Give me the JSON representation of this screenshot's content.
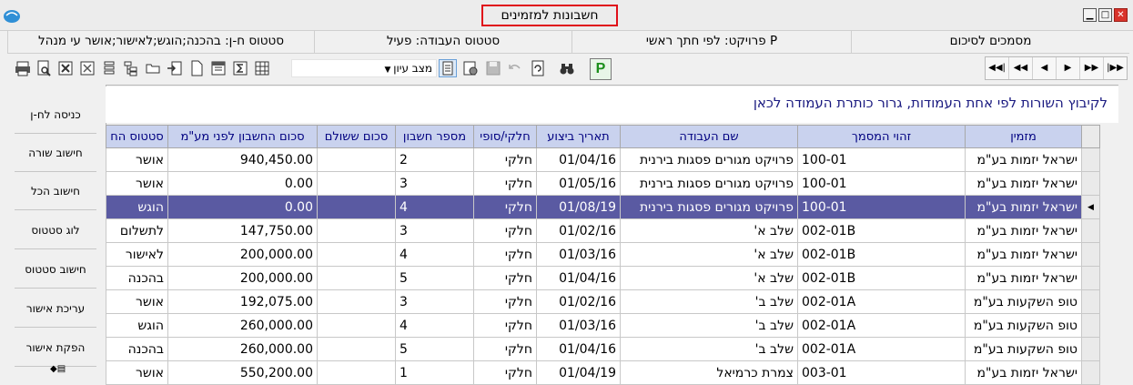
{
  "window": {
    "title": "חשבונות למזמינים"
  },
  "infobar": {
    "cells": [
      "סטטוס ח-ן: בהכנה;הוגש;לאישור;אושר עי מנהל",
      "סטטוס העבודה: פעיל",
      "פרויקט: לפי חתך ראשי P",
      "מסמכים לסיכום"
    ]
  },
  "toolbar": {
    "view_select": "מצב עיון",
    "p_button": "P"
  },
  "left_panel": {
    "buttons": [
      "כניסה לח-ן",
      "חישוב שורה",
      "חישוב הכל",
      "לוג סטטוס",
      "חישוב סטטוס",
      "עריכת אישור",
      "הפקת אישור"
    ]
  },
  "grid": {
    "group_hint": "לקיבוץ השורות לפי אחת העמודות, גרור כותרת העמודה לכאן",
    "columns": [
      "מזמין",
      "זהוי המסמך",
      "שם העבודה",
      "תאריך ביצוע",
      "חלקי/סופי",
      "מספר חשבון",
      "סכום ששולם",
      "סכום החשבון לפני מע\"מ",
      "סטטוס הח"
    ],
    "rows": [
      [
        "ישראל יזמות בע\"מ",
        "100-01",
        "פרויקט מגורים פסגות בירנית",
        "01/04/16",
        "חלקי",
        "2",
        "",
        "940,450.00",
        "אושר"
      ],
      [
        "ישראל יזמות בע\"מ",
        "100-01",
        "פרויקט מגורים פסגות בירנית",
        "01/05/16",
        "חלקי",
        "3",
        "",
        "0.00",
        "אושר"
      ],
      [
        "ישראל יזמות בע\"מ",
        "100-01",
        "פרויקט מגורים פסגות בירנית",
        "01/08/19",
        "חלקי",
        "4",
        "",
        "0.00",
        "הוגש"
      ],
      [
        "ישראל יזמות בע\"מ",
        "002-01B",
        "שלב א'",
        "01/02/16",
        "חלקי",
        "3",
        "",
        "147,750.00",
        "לתשלום"
      ],
      [
        "ישראל יזמות בע\"מ",
        "002-01B",
        "שלב א'",
        "01/03/16",
        "חלקי",
        "4",
        "",
        "200,000.00",
        "לאישור"
      ],
      [
        "ישראל יזמות בע\"מ",
        "002-01B",
        "שלב א'",
        "01/04/16",
        "חלקי",
        "5",
        "",
        "200,000.00",
        "בהכנה"
      ],
      [
        "טופ השקעות בע\"מ",
        "002-01A",
        "שלב ב'",
        "01/02/16",
        "חלקי",
        "3",
        "",
        "192,075.00",
        "אושר"
      ],
      [
        "טופ השקעות בע\"מ",
        "002-01A",
        "שלב ב'",
        "01/03/16",
        "חלקי",
        "4",
        "",
        "260,000.00",
        "הוגש"
      ],
      [
        "טופ השקעות בע\"מ",
        "002-01A",
        "שלב ב'",
        "01/04/16",
        "חלקי",
        "5",
        "",
        "260,000.00",
        "בהכנה"
      ],
      [
        "ישראל יזמות בע\"מ",
        "003-01",
        "צמרת כרמיאל",
        "01/04/19",
        "חלקי",
        "1",
        "",
        "550,200.00",
        "אושר"
      ]
    ],
    "selected_row": 2
  },
  "icons": {
    "toolbar_left": [
      "print-icon",
      "print-preview-icon",
      "excel-icon",
      "text-export-icon",
      "columns-icon",
      "tree-icon",
      "folder-icon",
      "export-icon",
      "new-doc-icon",
      "filter-icon",
      "sum-icon",
      "grid-icon"
    ],
    "toolbar_mid": [
      "details-icon",
      "settings-icon",
      "save-icon",
      "undo-icon",
      "refresh-icon",
      "binoculars-icon"
    ],
    "nav": [
      "first-icon",
      "prev-page-icon",
      "prev-icon",
      "next-icon",
      "next-page-icon",
      "last-icon"
    ]
  }
}
